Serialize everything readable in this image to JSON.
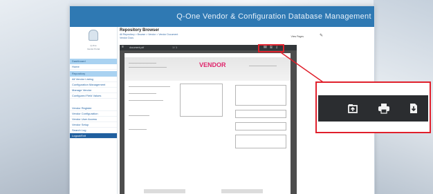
{
  "app": {
    "title": "Q-One Vendor & Configuration Database Management"
  },
  "sidebar": {
    "org_line1": "Q-One",
    "org_line2": "Vendor Portal",
    "section1": "Dashboard",
    "item_home": "Home",
    "section2": "Repository",
    "items": [
      "All Vendor Listing",
      "Configuration Management",
      "Manage Vendor",
      "Configured Field Values"
    ],
    "items2": [
      "Vendor Register",
      "Vendor Configuration",
      "Vendor User Access",
      "Vendor Setup",
      "Search Log"
    ],
    "active": "Logout/Exit"
  },
  "content": {
    "title": "Repository Browser",
    "breadcrumb": "All Repository > Browse > Vendor > Vendor Document",
    "subcrumb": "Vendor Docs",
    "view_label": "View",
    "view_value": "Pages",
    "pin_icon": "pin-icon"
  },
  "viewer": {
    "file_name": "document.pdf",
    "page": "1 / 1",
    "stamp": "VENDOR"
  },
  "callout": {
    "icons": [
      "open-file-icon",
      "print-icon",
      "download-icon"
    ]
  },
  "colors": {
    "header": "#2f79b3",
    "accent_red": "#e01f2b",
    "viewer_bar": "#323639"
  }
}
